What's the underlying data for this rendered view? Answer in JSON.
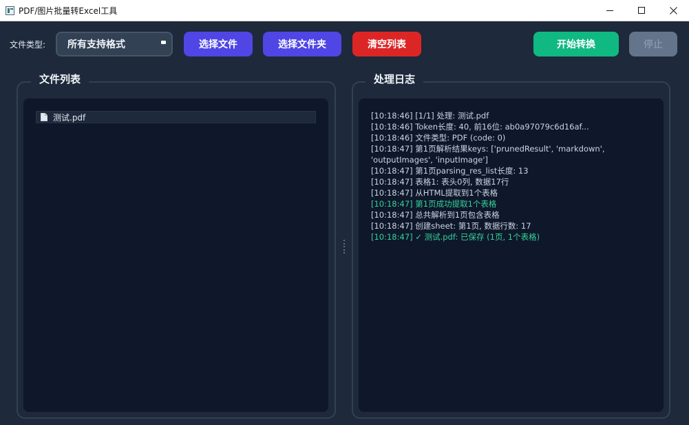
{
  "window": {
    "title": "PDF/图片批量转Excel工具",
    "icons": [
      "app-icon",
      "minimize-icon",
      "maximize-icon",
      "close-icon"
    ]
  },
  "toolbar": {
    "file_type_label": "文件类型:",
    "file_type_selected": "所有支持格式",
    "select_files_label": "选择文件",
    "select_folder_label": "选择文件夹",
    "clear_list_label": "清空列表",
    "start_label": "开始转换",
    "stop_label": "停止"
  },
  "colors": {
    "background": "#1e293b",
    "panel_bg": "#0f172a",
    "primary": "#4f46e5",
    "danger": "#dc2626",
    "success": "#10b981",
    "disabled": "#64748b",
    "log_success_text": "#34d399"
  },
  "file_list": {
    "title": "文件列表",
    "items": [
      {
        "name": "测试.pdf",
        "icon": "document-icon"
      }
    ]
  },
  "log": {
    "title": "处理日志",
    "lines": [
      "[10:18:46] [1/1] 处理: 测试.pdf",
      "[10:18:46] Token长度: 40, 前16位: ab0a97079c6d16af...",
      "[10:18:46] 文件类型: PDF (code: 0)",
      "[10:18:47] 第1页解析结果keys: ['prunedResult', 'markdown', 'outputImages', 'inputImage']",
      "[10:18:47] 第1页parsing_res_list长度: 13",
      "[10:18:47] 表格1: 表头0列, 数据17行",
      "[10:18:47] 从HTML提取到1个表格",
      "[10:18:47] 第1页成功提取1个表格",
      "[10:18:47] 总共解析到1页包含表格",
      "[10:18:47] 创建sheet: 第1页, 数据行数: 17",
      "[10:18:47] ✓ 测试.pdf: 已保存 (1页, 1个表格)"
    ]
  }
}
